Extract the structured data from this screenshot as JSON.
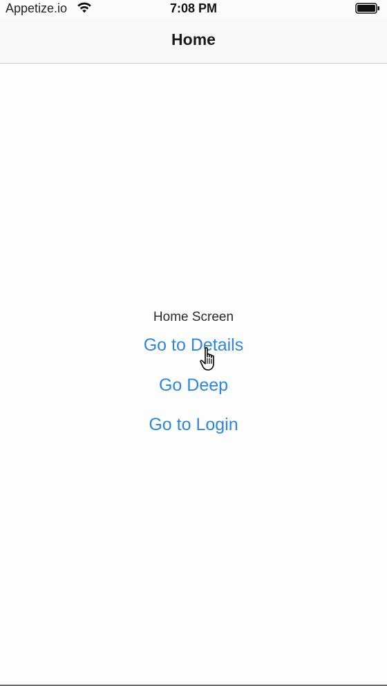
{
  "status_bar": {
    "carrier": "Appetize.io",
    "time": "7:08 PM",
    "wifi_icon": "wifi-icon",
    "battery_icon": "battery-icon"
  },
  "nav": {
    "title": "Home"
  },
  "main": {
    "screen_label": "Home Screen",
    "buttons": [
      {
        "label": "Go to Details"
      },
      {
        "label": "Go Deep"
      },
      {
        "label": "Go to Login"
      }
    ]
  },
  "colors": {
    "link": "#2f86dc",
    "background": "#fcfcfc",
    "nav_border": "#c9c9c9"
  },
  "cursor_icon": "pointer-hand-icon"
}
